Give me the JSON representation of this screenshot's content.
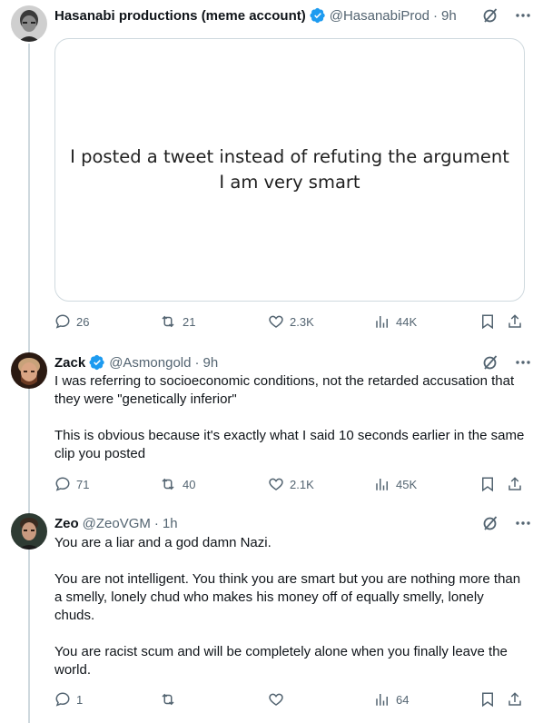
{
  "tweets": [
    {
      "name": "Hasanabi productions (meme account)",
      "handle": "@HasanabiProd",
      "dot": "·",
      "time": "9h",
      "media": {
        "line1": "I posted a tweet instead of refuting the argument",
        "line2": "I am very smart"
      },
      "replies": "26",
      "reposts": "21",
      "likes": "2.3K",
      "views": "44K"
    },
    {
      "name": "Zack",
      "handle": "@Asmongold",
      "dot": "·",
      "time": "9h",
      "text": "I was referring to socioeconomic conditions, not the retarded accusation that they were \"genetically inferior\"\n\nThis is obvious because it's exactly what I said 10 seconds earlier in the same clip you posted",
      "replies": "71",
      "reposts": "40",
      "likes": "2.1K",
      "views": "45K"
    },
    {
      "name": "Zeo",
      "handle": "@ZeoVGM",
      "dot": "·",
      "time": "1h",
      "text": "You are a liar and a god damn Nazi.\n\nYou are not intelligent. You think you are smart but you are nothing more than a smelly, lonely chud who makes his money off of equally smelly, lonely chuds.\n\nYou are racist scum and will be completely alone when you finally leave the world.",
      "replies": "1",
      "reposts": "",
      "likes": "",
      "views": "64"
    }
  ],
  "colors": {
    "text": "#0f1419",
    "secondary": "#536471",
    "verified": "#1d9bf0",
    "border": "#cfd9de"
  },
  "icons": [
    "verified-badge-icon",
    "grok-icon",
    "more-icon",
    "reply-icon",
    "repost-icon",
    "like-icon",
    "views-icon",
    "bookmark-icon",
    "share-icon"
  ]
}
